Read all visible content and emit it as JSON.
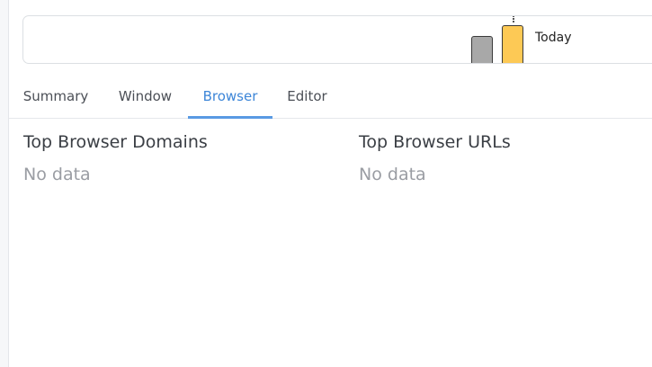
{
  "timeline": {
    "today_label": "Today"
  },
  "tabs": [
    {
      "label": "Summary",
      "active": false
    },
    {
      "label": "Window",
      "active": false
    },
    {
      "label": "Browser",
      "active": true
    },
    {
      "label": "Editor",
      "active": false
    }
  ],
  "panels": {
    "domains": {
      "title": "Top Browser Domains",
      "empty_text": "No data"
    },
    "urls": {
      "title": "Top Browser URLs",
      "empty_text": "No data"
    }
  },
  "colors": {
    "accent": "#3d86d8",
    "today_bar": "#fdc955",
    "previous_bar": "#a8a8a8"
  }
}
